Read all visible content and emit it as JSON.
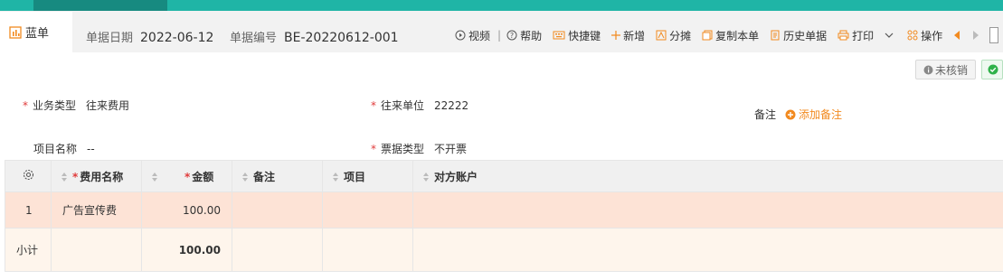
{
  "document": {
    "tab_title": "蓝单",
    "date_label": "单据日期",
    "date_value": "2022-06-12",
    "number_label": "单据编号",
    "number_value": "BE-20220612-001"
  },
  "toolbar": {
    "video": "视频",
    "separator": "|",
    "help": "帮助",
    "shortcut": "快捷键",
    "add": "新增",
    "allocate": "分摊",
    "copy": "复制本单",
    "history": "历史单据",
    "print": "打印",
    "operate": "操作"
  },
  "status": {
    "unverified": "未核销"
  },
  "form": {
    "business_type_label": "业务类型",
    "business_type_value": "往来费用",
    "partner_label": "往来单位",
    "partner_value": "22222",
    "remark_label": "备注",
    "add_remark": "添加备注",
    "project_label": "项目名称",
    "project_value": "--",
    "invoice_type_label": "票据类型",
    "invoice_type_value": "不开票",
    "required_mark": "*"
  },
  "table": {
    "columns": [
      "费用名称",
      "金额",
      "备注",
      "项目",
      "对方账户"
    ],
    "rows": [
      {
        "index": "1",
        "name": "广告宣传费",
        "amount": "100.00",
        "remark": "",
        "project": "",
        "account": ""
      }
    ],
    "subtotal_label": "小计",
    "subtotal_amount": "100.00"
  },
  "colors": {
    "accent": "#1fb5a6",
    "orange": "#f28a1f",
    "required": "#e03b3b",
    "row_highlight": "#fde3d6"
  }
}
